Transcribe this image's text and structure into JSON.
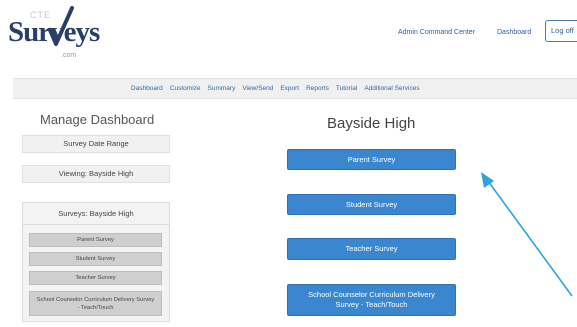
{
  "logo": {
    "prefix": "CTE",
    "name": "Surveys",
    "suffix": ".com"
  },
  "header": {
    "admin_link": "Admin Command Center",
    "dashboard_link": "Dashboard",
    "logoff_label": "Log off"
  },
  "nav": {
    "items": [
      "Dashboard",
      "Customize",
      "Summary",
      "View/Send",
      "Export",
      "Reports",
      "Tutorial",
      "Additional Services"
    ]
  },
  "sidebar": {
    "title": "Manage Dashboard",
    "date_range_label": "Survey Date Range",
    "viewing_label": "Viewing: Bayside High",
    "surveys_heading": "Surveys: Bayside High",
    "survey_items": [
      "Parent Survey",
      "Student Survey",
      "Teacher Survey",
      "School Counselor Curriculum Delivery Survey - Teach/Touch"
    ]
  },
  "main": {
    "school_name": "Bayside High",
    "survey_buttons": [
      "Parent Survey",
      "Student Survey",
      "Teacher Survey",
      "School Counselor Curriculum Delivery Survey - Teach/Touch"
    ]
  },
  "colors": {
    "brand_navy": "#2a3f68",
    "link_blue": "#2f5f96",
    "button_blue": "#3a87cf",
    "arrow_blue": "#2ea3e0"
  }
}
